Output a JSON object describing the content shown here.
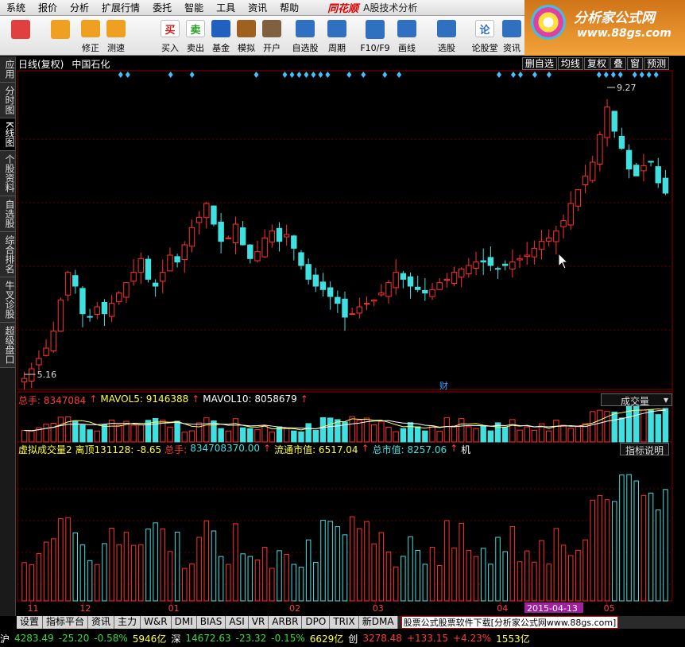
{
  "menu": [
    "系统",
    "报价",
    "分析",
    "扩展行情",
    "委托",
    "智能",
    "工具",
    "资讯",
    "帮助"
  ],
  "brand": "同花顺",
  "app_title": "A股技术分析",
  "toolbar": [
    {
      "label": "",
      "icon": "grid-icon",
      "color": "#e04040"
    },
    {
      "label": "",
      "icon": "back-arrow-icon",
      "color": "#f0a020"
    },
    {
      "label": "修正",
      "icon": "up-down-arrow-icon",
      "color": "#f0a020"
    },
    {
      "label": "测速",
      "icon": "refresh-icon",
      "color": "#f0a020"
    },
    {
      "label": "买入",
      "icon": "buy-icon",
      "color": "#d02020",
      "glyph": "买"
    },
    {
      "label": "卖出",
      "icon": "sell-icon",
      "color": "#20a020",
      "glyph": "卖"
    },
    {
      "label": "基金",
      "icon": "fund-icon",
      "color": "#2060c0"
    },
    {
      "label": "模拟",
      "icon": "hammer-icon",
      "color": "#a06020"
    },
    {
      "label": "开户",
      "icon": "lock-icon",
      "color": "#806040"
    },
    {
      "label": "自选股",
      "icon": "star-folder-icon",
      "color": "#3070c0"
    },
    {
      "label": "周期",
      "icon": "clock-icon",
      "color": "#3070c0"
    },
    {
      "label": "F10/F9",
      "icon": "document-icon",
      "color": "#3070c0"
    },
    {
      "label": "画线",
      "icon": "pen-icon",
      "color": "#3070c0"
    },
    {
      "label": "选股",
      "icon": "filter-icon",
      "color": "#3070c0"
    },
    {
      "label": "论股堂",
      "icon": "forum-icon",
      "color": "#3070c0",
      "glyph": "论"
    },
    {
      "label": "资讯",
      "icon": "news-icon",
      "color": "#3070c0"
    }
  ],
  "logo": {
    "line1": "分析家公式网",
    "line2": "www.88gs.com"
  },
  "sidebar": [
    "应用",
    "分时图",
    "K线图",
    "个股资料",
    "自选股",
    "综合排名",
    "牛叉诊股",
    "超级盘口"
  ],
  "chart": {
    "period": "日线(复权)",
    "stock": "中国石化",
    "top_buttons": [
      "删自选",
      "均线",
      "复权",
      "叠",
      "窗",
      "预测"
    ],
    "high_label": "9.27",
    "low_label": "5.16",
    "marker": "财"
  },
  "volume": {
    "total": "总手: 8347084",
    "mavol5": "MAVOL5: 9146388",
    "mavol10": "MAVOL10: 8058679",
    "selector": "成交量"
  },
  "indicator": {
    "name": "虚拟成交量2 离顶131128: -8.65",
    "total": "总手: 834708370.00",
    "float_cap": "流通市值: 6517.04",
    "total_cap": "总市值: 8257.06",
    "extra": "机",
    "help": "指标说明"
  },
  "x_axis": [
    {
      "label": "11",
      "pos": 0.02
    },
    {
      "label": "12",
      "pos": 0.1
    },
    {
      "label": "01",
      "pos": 0.235
    },
    {
      "label": "02",
      "pos": 0.42
    },
    {
      "label": "03",
      "pos": 0.547
    },
    {
      "label": "04",
      "pos": 0.737
    },
    {
      "label": "05",
      "pos": 0.9
    }
  ],
  "date_cursor": "2015-04-13",
  "bottom_tabs": [
    "设置",
    "指标平台",
    "资讯",
    "主力",
    "W&R",
    "DMI",
    "BIAS",
    "ASI",
    "VR",
    "ARBR",
    "DPO",
    "TRIX",
    "新DMA"
  ],
  "promo": "股票公式股票软件下载[分析家公式网www.88gs.com]",
  "status": [
    {
      "text": "沪",
      "c": "white"
    },
    {
      "text": "4283.49",
      "c": "green"
    },
    {
      "text": "-25.20",
      "c": "green"
    },
    {
      "text": "-0.58%",
      "c": "green"
    },
    {
      "text": "5946亿",
      "c": "yellow"
    },
    {
      "text": "深",
      "c": "white"
    },
    {
      "text": "14672.63",
      "c": "green"
    },
    {
      "text": "-23.32",
      "c": "green"
    },
    {
      "text": "-0.15%",
      "c": "green"
    },
    {
      "text": "6629亿",
      "c": "yellow"
    },
    {
      "text": "创",
      "c": "white"
    },
    {
      "text": "3278.48",
      "c": "red"
    },
    {
      "text": "+133.15",
      "c": "red"
    },
    {
      "text": "+4.23%",
      "c": "red"
    },
    {
      "text": "1553亿",
      "c": "yellow"
    }
  ],
  "chart_data": {
    "type": "candlestick",
    "price_range": [
      5.0,
      9.5
    ],
    "closes": [
      5.16,
      5.3,
      5.45,
      5.6,
      5.85,
      6.3,
      6.7,
      6.5,
      6.1,
      6.05,
      6.2,
      6.1,
      6.25,
      6.4,
      6.55,
      6.7,
      6.9,
      6.6,
      6.5,
      6.7,
      6.95,
      6.85,
      7.1,
      7.35,
      7.5,
      7.7,
      7.4,
      7.15,
      7.2,
      7.4,
      7.1,
      6.9,
      7.0,
      7.2,
      7.3,
      7.15,
      7.25,
      7.05,
      6.8,
      6.6,
      6.5,
      6.45,
      6.35,
      6.25,
      6.05,
      6.1,
      6.2,
      6.25,
      6.3,
      6.4,
      6.55,
      6.7,
      6.6,
      6.5,
      6.45,
      6.4,
      6.45,
      6.55,
      6.6,
      6.7,
      6.75,
      6.8,
      6.85,
      6.85,
      6.8,
      6.75,
      6.8,
      6.85,
      6.9,
      6.95,
      7.05,
      7.15,
      7.2,
      7.3,
      7.45,
      7.7,
      7.9,
      8.1,
      8.3,
      8.7,
      9.1,
      8.75,
      8.5,
      8.2,
      8.1,
      8.25,
      8.3,
      8.0,
      7.85
    ],
    "volume_scale": 1.0
  }
}
